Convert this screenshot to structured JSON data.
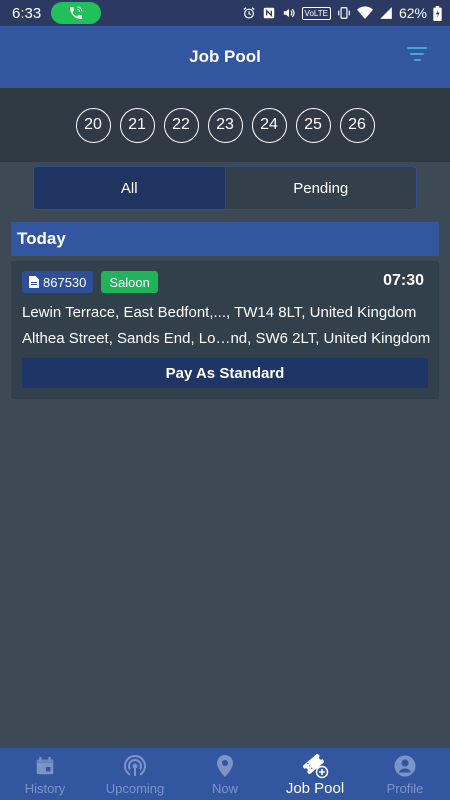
{
  "status_bar": {
    "time": "6:33",
    "volte": "VoLTE",
    "battery_pct": "62%"
  },
  "app_bar": {
    "title": "Job Pool",
    "filter_icon": "filter-icon"
  },
  "dates": [
    "20",
    "21",
    "22",
    "23",
    "24",
    "25",
    "26"
  ],
  "segments": {
    "all_label": "All",
    "pending_label": "Pending",
    "selected": "All"
  },
  "section": {
    "title": "Today"
  },
  "job": {
    "id": "867530",
    "vehicle_type": "Saloon",
    "time": "07:30",
    "pickup": "Lewin Terrace, East Bedfont,..., TW14 8LT, United Kingdom",
    "dropoff": "Althea Street, Sands End, Lo…nd, SW6 2LT, United Kingdom",
    "payment_label": "Pay As Standard"
  },
  "bottom_nav": {
    "items": [
      {
        "label": "History",
        "icon": "calendar-icon"
      },
      {
        "label": "Upcoming",
        "icon": "broadcast-icon"
      },
      {
        "label": "Now",
        "icon": "location-pin-icon"
      },
      {
        "label": "Job Pool",
        "icon": "ticket-add-icon"
      },
      {
        "label": "Profile",
        "icon": "account-icon"
      }
    ],
    "active": "Job Pool"
  },
  "colors": {
    "status_bar": "#2c3a63",
    "app_bar": "#3356a0",
    "background": "#3d4a55",
    "date_strip": "#2f3a44",
    "badge_green": "#21b35a",
    "nav_inactive": "#7d95c6"
  }
}
